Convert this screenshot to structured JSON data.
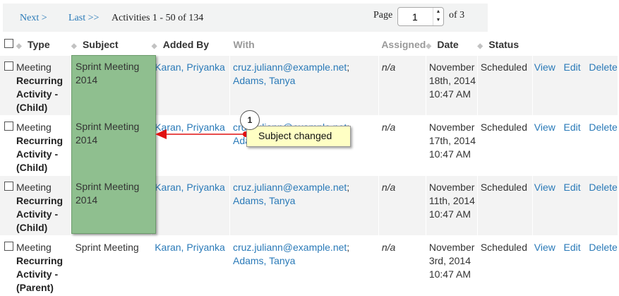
{
  "pager": {
    "next": "Next >",
    "last": "Last >>",
    "count": "Activities 1 - 50 of 134",
    "page_label": "Page",
    "page_value": "1",
    "of": "of 3"
  },
  "columns": {
    "type": "Type",
    "subject": "Subject",
    "added_by": "Added By",
    "with": "With",
    "assigned": "Assigned",
    "date": "Date",
    "status": "Status"
  },
  "rows": [
    {
      "type1": "Meeting",
      "type2": "Recurring Activity - (Child)",
      "subject": "Sprint Meeting 2014",
      "added_by": "Karan, Priyanka",
      "with_email": "cruz.juliann@example.net",
      "with_name": "Adams, Tanya",
      "assigned": "n/a",
      "date": "November 18th, 2014 10:47 AM",
      "status": "Scheduled",
      "view": "View",
      "edit": "Edit",
      "delete": "Delete"
    },
    {
      "type1": "Meeting",
      "type2": "Recurring Activity - (Child)",
      "subject": "Sprint Meeting 2014",
      "added_by": "Karan, Priyanka",
      "with_email": "cruz.juliann@example.net",
      "with_name": "Adams, Tanya",
      "assigned": "n/a",
      "date": "November 17th, 2014 10:47 AM",
      "status": "Scheduled",
      "view": "View",
      "edit": "Edit",
      "delete": "Delete"
    },
    {
      "type1": "Meeting",
      "type2": "Recurring Activity - (Child)",
      "subject": "Sprint Meeting 2014",
      "added_by": "Karan, Priyanka",
      "with_email": "cruz.juliann@example.net",
      "with_name": "Adams, Tanya",
      "assigned": "n/a",
      "date": "November 11th, 2014 10:47 AM",
      "status": "Scheduled",
      "view": "View",
      "edit": "Edit",
      "delete": "Delete"
    },
    {
      "type1": "Meeting",
      "type2": "Recurring Activity - (Parent)",
      "subject": "Sprint Meeting",
      "added_by": "Karan, Priyanka",
      "with_email": "cruz.juliann@example.net",
      "with_name": "Adams, Tanya",
      "assigned": "n/a",
      "date": "November 3rd, 2014 10:47 AM",
      "status": "Scheduled",
      "view": "View",
      "edit": "Edit",
      "delete": "Delete"
    }
  ],
  "annotation": {
    "number": "1",
    "text": "Subject changed",
    "highlight_color": "#8fbf8f",
    "arrow_color": "#e01010",
    "callout_color": "#ffffc4"
  }
}
